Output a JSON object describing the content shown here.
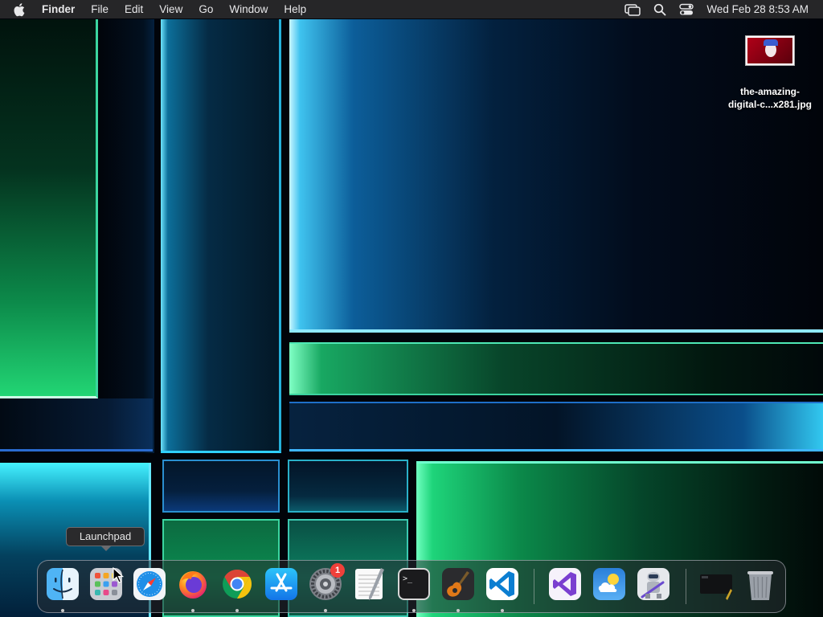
{
  "menubar": {
    "app_name": "Finder",
    "menus": [
      "File",
      "Edit",
      "View",
      "Go",
      "Window",
      "Help"
    ],
    "clock": "Wed Feb 28  8:53 AM"
  },
  "desktop_file": {
    "name_line1": "the-amazing-",
    "name_line2": "digital-c...x281.jpg"
  },
  "tooltip": {
    "label": "Launchpad"
  },
  "dock": {
    "settings_badge": "1",
    "terminal_prompt": ">_"
  },
  "colors": {
    "menubar_bg": "#262628",
    "badge_red": "#f0403a",
    "vscode_blue": "#0b7ed1",
    "chrome_red": "#db4437",
    "chrome_yellow": "#f4c20d",
    "chrome_green": "#0f9d58"
  }
}
